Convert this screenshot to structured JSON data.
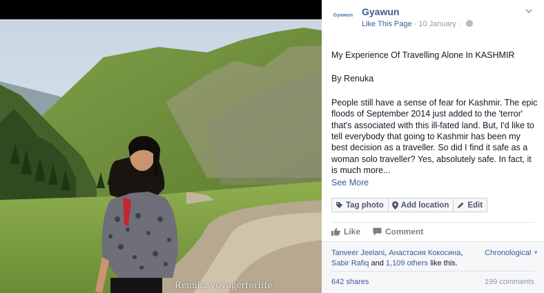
{
  "photo": {
    "watermark": "Renuka voyagerforlife"
  },
  "header": {
    "logo_text": "Gyawun",
    "page_name": "Gyawun",
    "like_link": "Like This Page",
    "separator": " · ",
    "date": "10 January",
    "date_separator": " · "
  },
  "post": {
    "title": "My Experience Of Travelling Alone In KASHMIR",
    "author": "By Renuka",
    "body": "People still have a sense of fear for Kashmir. The epic floods of September 2014 just added to the 'terror' that's associated with this ill-fated land. But, I'd like to tell everybody that going to Kashmir has been my best decision as a traveller. So did I find it safe as a woman solo traveller? Yes, absolutely safe. In fact, it is much more...",
    "see_more": "See More"
  },
  "photo_actions": {
    "tag_photo": "Tag photo",
    "add_location": "Add location",
    "edit": "Edit"
  },
  "feedback": {
    "like": "Like",
    "comment": "Comment"
  },
  "social": {
    "liker_1": "Tanveer Jeelani",
    "sep_1": ", ",
    "liker_2": "Анастасия Кокосина",
    "sep_2": ",",
    "liker_3": "Sabir Rafiq",
    "and": " and ",
    "others": "1,109 others",
    "like_this": " like this.",
    "order": "Chronological",
    "shares": "642 shares",
    "comments": "199 comments"
  },
  "colors": {
    "link_blue": "#3b5998",
    "meta_grey": "#9197a3",
    "button_border": "#ccd0d5",
    "social_bg": "#f6f7f9"
  },
  "icons": [
    "tag-icon",
    "location-pin-icon",
    "pencil-icon",
    "thumbs-up-icon",
    "comment-bubble-icon",
    "globe-icon",
    "chevron-down-icon"
  ]
}
